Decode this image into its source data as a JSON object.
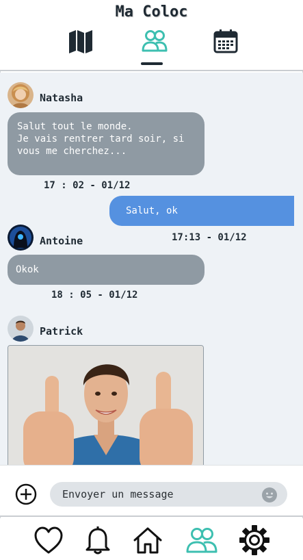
{
  "app": {
    "title": "Ma Coloc"
  },
  "tabs": [
    {
      "icon": "map-icon",
      "active": false
    },
    {
      "icon": "group-icon",
      "active": true
    },
    {
      "icon": "calendar-icon",
      "active": false
    }
  ],
  "messages": [
    {
      "sender": "Natasha",
      "text_lines": [
        "Salut tout le monde.",
        "Je vais rentrer tard soir, si",
        "vous me cherchez..."
      ],
      "time": "17 : 02 - 01/12",
      "direction": "in"
    },
    {
      "sender": "",
      "text_lines": [
        "Salut, ok"
      ],
      "time": "17:13 - 01/12",
      "direction": "out"
    },
    {
      "sender": "Antoine",
      "text_lines": [
        "Okok"
      ],
      "time": "18 : 05 - 01/12",
      "direction": "in"
    },
    {
      "sender": "Patrick",
      "image": "photo of smiling man giving two thumbs up",
      "direction": "in"
    }
  ],
  "composer": {
    "placeholder": "Envoyer un message",
    "add_icon": "plus-circle-icon",
    "emoji_icon": "emoji-icon"
  },
  "bottom_nav": [
    {
      "icon": "heart-icon",
      "active": false
    },
    {
      "icon": "bell-icon",
      "active": false
    },
    {
      "icon": "home-icon",
      "active": false
    },
    {
      "icon": "group-icon",
      "active": true
    },
    {
      "icon": "gear-icon",
      "active": false
    }
  ],
  "colors": {
    "accent": "#3dbfb0",
    "dark": "#1f2a33",
    "incoming_bubble": "#8f9aa3",
    "outgoing_bubble": "#5591e0",
    "chat_bg": "#eef2f6"
  }
}
